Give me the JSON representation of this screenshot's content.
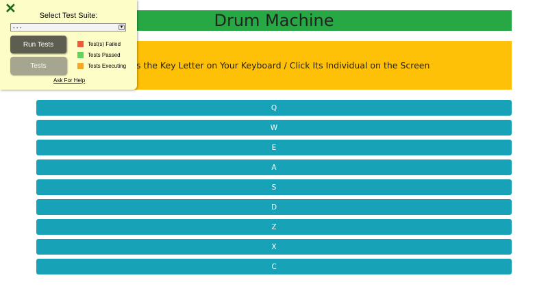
{
  "app": {
    "title": "Drum Machine",
    "instructions": "Press the Key Letter on Your Keyboard / Click Its Individual on the Screen"
  },
  "pads": [
    "Q",
    "W",
    "E",
    "A",
    "S",
    "D",
    "Z",
    "X",
    "C"
  ],
  "test_panel": {
    "close_icon": "✕",
    "suite_label": "Select Test Suite:",
    "suite_selected": "- - -",
    "run_tests_label": "Run Tests",
    "tests_label": "Tests",
    "legend": [
      {
        "label": "Test(s) Failed",
        "color": "#f05a3c"
      },
      {
        "label": "Tests Passed",
        "color": "#5ed45e"
      },
      {
        "label": "Tests Executing",
        "color": "#f5a623"
      }
    ],
    "help_label": "Ask For Help"
  },
  "colors": {
    "title_bg": "#28a745",
    "instructions_bg": "#ffc107",
    "pad_bg": "#17a2b8",
    "panel_bg": "#fdfdc8"
  }
}
